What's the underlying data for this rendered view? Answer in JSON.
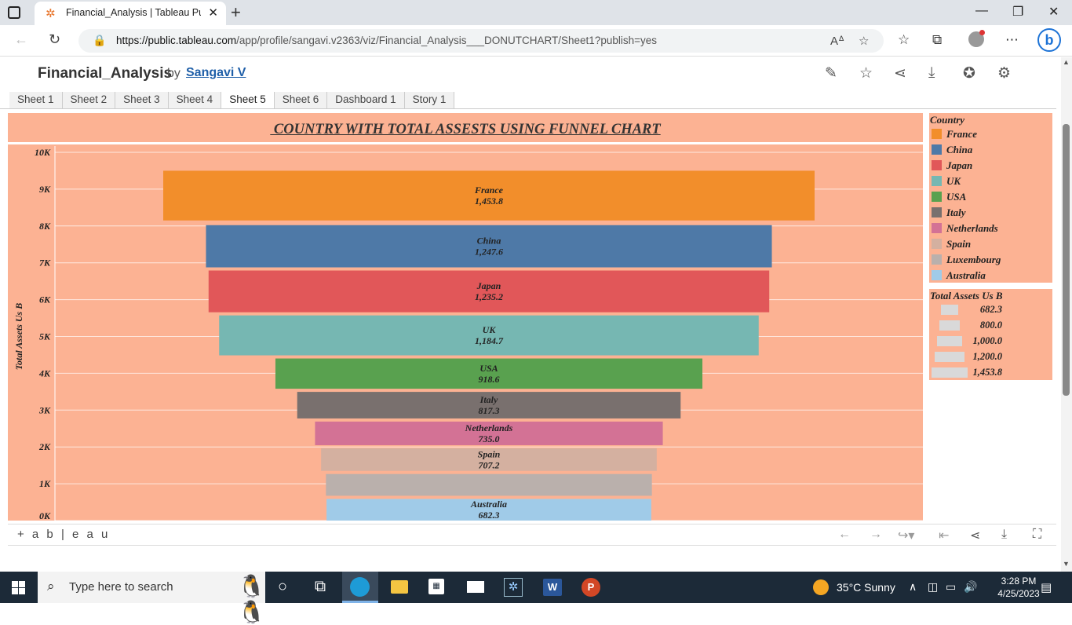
{
  "browser": {
    "tab_title": "Financial_Analysis | Tableau Publi",
    "url_host": "https://public.tableau.com",
    "url_path": "/app/profile/sangavi.v2363/viz/Financial_Analysis___DONUTCHART/Sheet1?publish=yes"
  },
  "header": {
    "title": "Financial_Analysis",
    "by": "by",
    "author": "Sangavi V"
  },
  "sheet_tabs": [
    "Sheet 1",
    "Sheet 2",
    "Sheet 3",
    "Sheet 4",
    "Sheet 5",
    "Sheet 6",
    "Dashboard 1",
    "Story 1"
  ],
  "active_tab": "Sheet 5",
  "chart_data": {
    "type": "bar",
    "title": " COUNTRY WITH TOTAL ASSESTS USING FUNNEL CHART",
    "ylabel": "Total Assets Us B",
    "ylim": [
      0,
      10000
    ],
    "y_ticks": [
      "0K",
      "1K",
      "2K",
      "3K",
      "4K",
      "5K",
      "6K",
      "7K",
      "8K",
      "9K",
      "10K"
    ],
    "categories": [
      "France",
      "China",
      "Japan",
      "UK",
      "USA",
      "Italy",
      "Netherlands",
      "Spain",
      "Luxembourg",
      "Australia"
    ],
    "values": [
      1453.8,
      1247.6,
      1235.2,
      1184.7,
      918.6,
      817.3,
      735.0,
      707.2,
      685.0,
      682.3
    ],
    "value_labels": [
      "1,453.8",
      "1,247.6",
      "1,235.2",
      "1,184.7",
      "918.6",
      "817.3",
      "735.0",
      "707.2",
      "",
      "682.3"
    ],
    "show_category_label": [
      true,
      true,
      true,
      true,
      true,
      true,
      true,
      true,
      false,
      true
    ],
    "colors": [
      "#f28e2b",
      "#4e79a7",
      "#e15759",
      "#76b7b2",
      "#59a14f",
      "#79706e",
      "#d37295",
      "#d4b0a0",
      "#bab0ac",
      "#a0cbe8"
    ]
  },
  "legend": {
    "title": "Country",
    "items": [
      {
        "label": "France",
        "color": "#f28e2b"
      },
      {
        "label": "China",
        "color": "#4e79a7"
      },
      {
        "label": "Japan",
        "color": "#e15759"
      },
      {
        "label": "UK",
        "color": "#76b7b2"
      },
      {
        "label": "USA",
        "color": "#59a14f"
      },
      {
        "label": "Italy",
        "color": "#79706e"
      },
      {
        "label": "Netherlands",
        "color": "#d37295"
      },
      {
        "label": "Spain",
        "color": "#d4b0a0"
      },
      {
        "label": "Luxembourg",
        "color": "#bab0ac"
      },
      {
        "label": "Australia",
        "color": "#a0cbe8"
      }
    ]
  },
  "size_legend": {
    "title": "Total Assets Us B",
    "items": [
      {
        "label": "682.3",
        "value": 682.3
      },
      {
        "label": "800.0",
        "value": 800.0
      },
      {
        "label": "1,000.0",
        "value": 1000.0
      },
      {
        "label": "1,200.0",
        "value": 1200.0
      },
      {
        "label": "1,453.8",
        "value": 1453.8
      }
    ]
  },
  "footer": {
    "logo": "+ a b | e a u"
  },
  "taskbar": {
    "search_placeholder": "Type here to search",
    "weather": "35°C  Sunny",
    "time": "3:28 PM",
    "date": "4/25/2023"
  }
}
